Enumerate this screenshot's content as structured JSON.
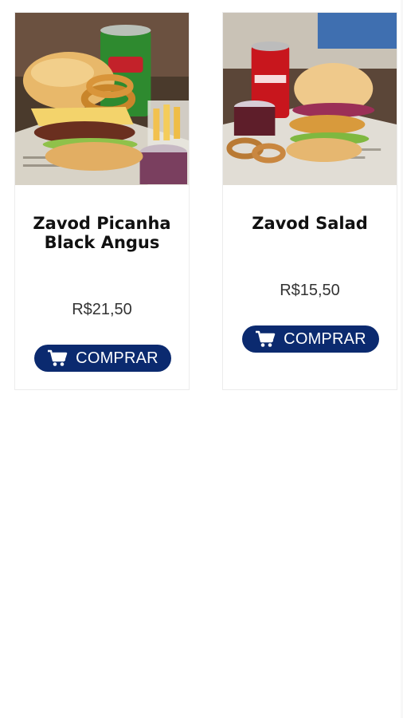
{
  "products": [
    {
      "name": "Zavod Picanha Black Angus",
      "price": "R$21,50",
      "buy_label": "COMPRAR",
      "image": "burger-with-onion-rings-fries-soda-photo",
      "cart_icon": "cart-icon"
    },
    {
      "name": "Zavod Salad",
      "price": "R$15,50",
      "buy_label": "COMPRAR",
      "image": "burger-salad-with-coca-cola-photo",
      "cart_icon": "cart-icon"
    }
  ],
  "colors": {
    "button_bg": "#0b2a6f",
    "button_text": "#ffffff",
    "title_text": "#111111",
    "price_text": "#333333",
    "card_border": "#ececec"
  }
}
